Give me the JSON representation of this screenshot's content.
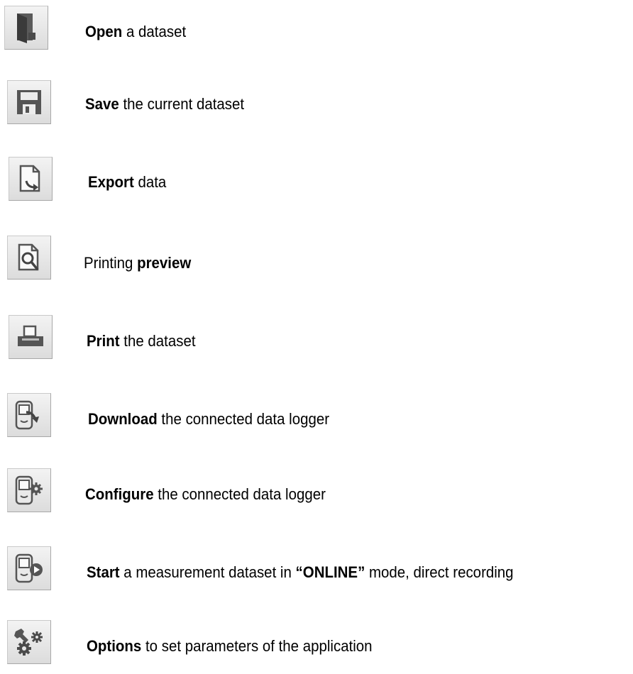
{
  "toolbar_help": [
    {
      "icon": "open-folder-icon",
      "bold": "Open",
      "rest": " a dataset"
    },
    {
      "icon": "save-disk-icon",
      "bold": "Save",
      "rest": " the current dataset"
    },
    {
      "icon": "export-document-icon",
      "bold": "Export",
      "rest": " data"
    },
    {
      "icon": "print-preview-icon",
      "pre": "Printing ",
      "bold": "preview"
    },
    {
      "icon": "printer-icon",
      "bold": "Print",
      "rest": " the dataset"
    },
    {
      "icon": "download-logger-icon",
      "bold": "Download",
      "rest": " the connected data logger"
    },
    {
      "icon": "configure-logger-icon",
      "bold": "Configure",
      "rest": " the connected data logger"
    },
    {
      "icon": "start-online-icon",
      "bold": "Start",
      "rest": " a measurement dataset in ",
      "bold2": "“ONLINE”",
      "rest2": " mode, direct recording"
    },
    {
      "icon": "options-gears-icon",
      "bold": "Options",
      "rest": " to set parameters of the application"
    }
  ]
}
